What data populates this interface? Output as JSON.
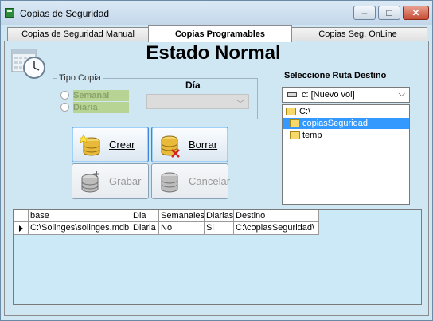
{
  "window": {
    "title": "Copias de Seguridad",
    "minimize": "–",
    "maximize": "□",
    "close": "✕"
  },
  "tabs": [
    {
      "label": "Copias de Seguridad Manual",
      "active": false
    },
    {
      "label": "Copias Programables",
      "active": true
    },
    {
      "label": "Copias Seg. OnLine",
      "active": false
    }
  ],
  "main": {
    "heading": "Estado Normal",
    "tipo_copia": {
      "label": "Tipo Copia",
      "options": [
        {
          "label": "Semanal"
        },
        {
          "label": "Diaria"
        }
      ]
    },
    "dia": {
      "label": "Día",
      "value": ""
    },
    "buttons": {
      "crear": "Crear",
      "borrar": "Borrar",
      "grabar": "Grabar",
      "cancelar": "Cancelar"
    },
    "destino": {
      "label": "Seleccione Ruta Destino",
      "drive": "c: [Nuevo vol]",
      "tree": [
        "C:\\",
        "copiasSeguridad",
        "temp"
      ]
    }
  },
  "grid": {
    "columns": [
      "base",
      "Dia",
      "Semanales",
      "Diarias",
      "Destino"
    ],
    "rows": [
      [
        "C:\\Solinges\\solinges.mdb",
        "Diaria",
        "No",
        "Si",
        "C:\\copiasSeguridad\\"
      ]
    ]
  },
  "colors": {
    "background": "#cfe6f3",
    "selection": "#3399ff",
    "radio_label_bg": "#b7d495"
  }
}
